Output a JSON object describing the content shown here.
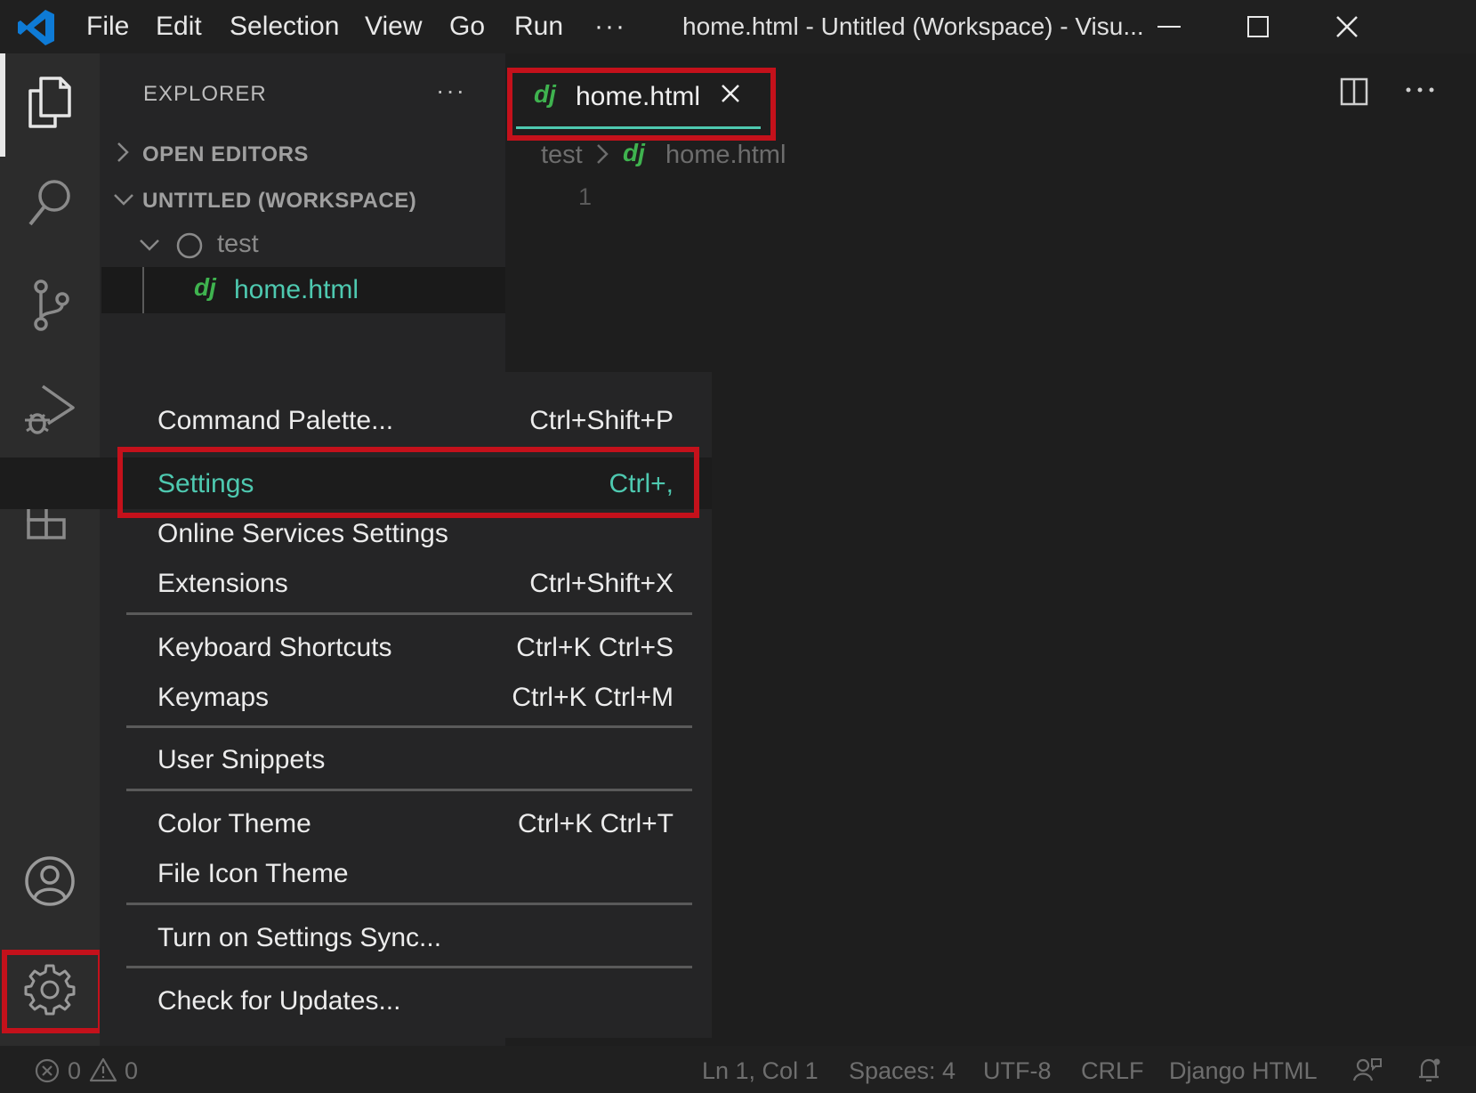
{
  "titlebar": {
    "menus": [
      "File",
      "Edit",
      "Selection",
      "View",
      "Go",
      "Run"
    ],
    "more": "···",
    "window_title": "home.html - Untitled (Workspace) - Visu..."
  },
  "sidebar": {
    "title": "EXPLORER",
    "more": "···",
    "open_editors": "OPEN EDITORS",
    "workspace": "UNTITLED (WORKSPACE)",
    "folder": "test",
    "file_icon": "dj",
    "file": "home.html"
  },
  "editor": {
    "tab_icon": "dj",
    "tab_label": "home.html",
    "breadcrumb_folder": "test",
    "breadcrumb_icon": "dj",
    "breadcrumb_file": "home.html",
    "line_number": "1"
  },
  "menu": {
    "items": [
      {
        "label": "Command Palette...",
        "shortcut": "Ctrl+Shift+P"
      },
      {
        "label": "Settings",
        "shortcut": "Ctrl+,"
      },
      {
        "label": "Online Services Settings",
        "shortcut": ""
      },
      {
        "label": "Extensions",
        "shortcut": "Ctrl+Shift+X"
      },
      {
        "label": "Keyboard Shortcuts",
        "shortcut": "Ctrl+K Ctrl+S"
      },
      {
        "label": "Keymaps",
        "shortcut": "Ctrl+K Ctrl+M"
      },
      {
        "label": "User Snippets",
        "shortcut": ""
      },
      {
        "label": "Color Theme",
        "shortcut": "Ctrl+K Ctrl+T"
      },
      {
        "label": "File Icon Theme",
        "shortcut": ""
      },
      {
        "label": "Turn on Settings Sync...",
        "shortcut": ""
      },
      {
        "label": "Check for Updates...",
        "shortcut": ""
      }
    ]
  },
  "statusbar": {
    "errors": "0",
    "warnings": "0",
    "position": "Ln 1, Col 1",
    "spaces": "Spaces: 4",
    "encoding": "UTF-8",
    "eol": "CRLF",
    "language": "Django HTML"
  },
  "colors": {
    "accent": "#4ec9b0",
    "highlight_box": "#c4111b",
    "django_icon": "#3fb34f",
    "vscode_blue": "#0e7bd6"
  },
  "icons": [
    "vscode-logo-icon",
    "minimize-icon",
    "maximize-icon",
    "close-icon",
    "files-icon",
    "search-icon",
    "source-control-icon",
    "run-debug-icon",
    "extensions-icon",
    "account-icon",
    "gear-icon",
    "split-editor-icon",
    "ellipsis-icon",
    "chevron-right-icon",
    "chevron-down-icon",
    "folder-circle-icon",
    "error-icon",
    "warning-icon",
    "feedback-icon",
    "bell-icon"
  ]
}
